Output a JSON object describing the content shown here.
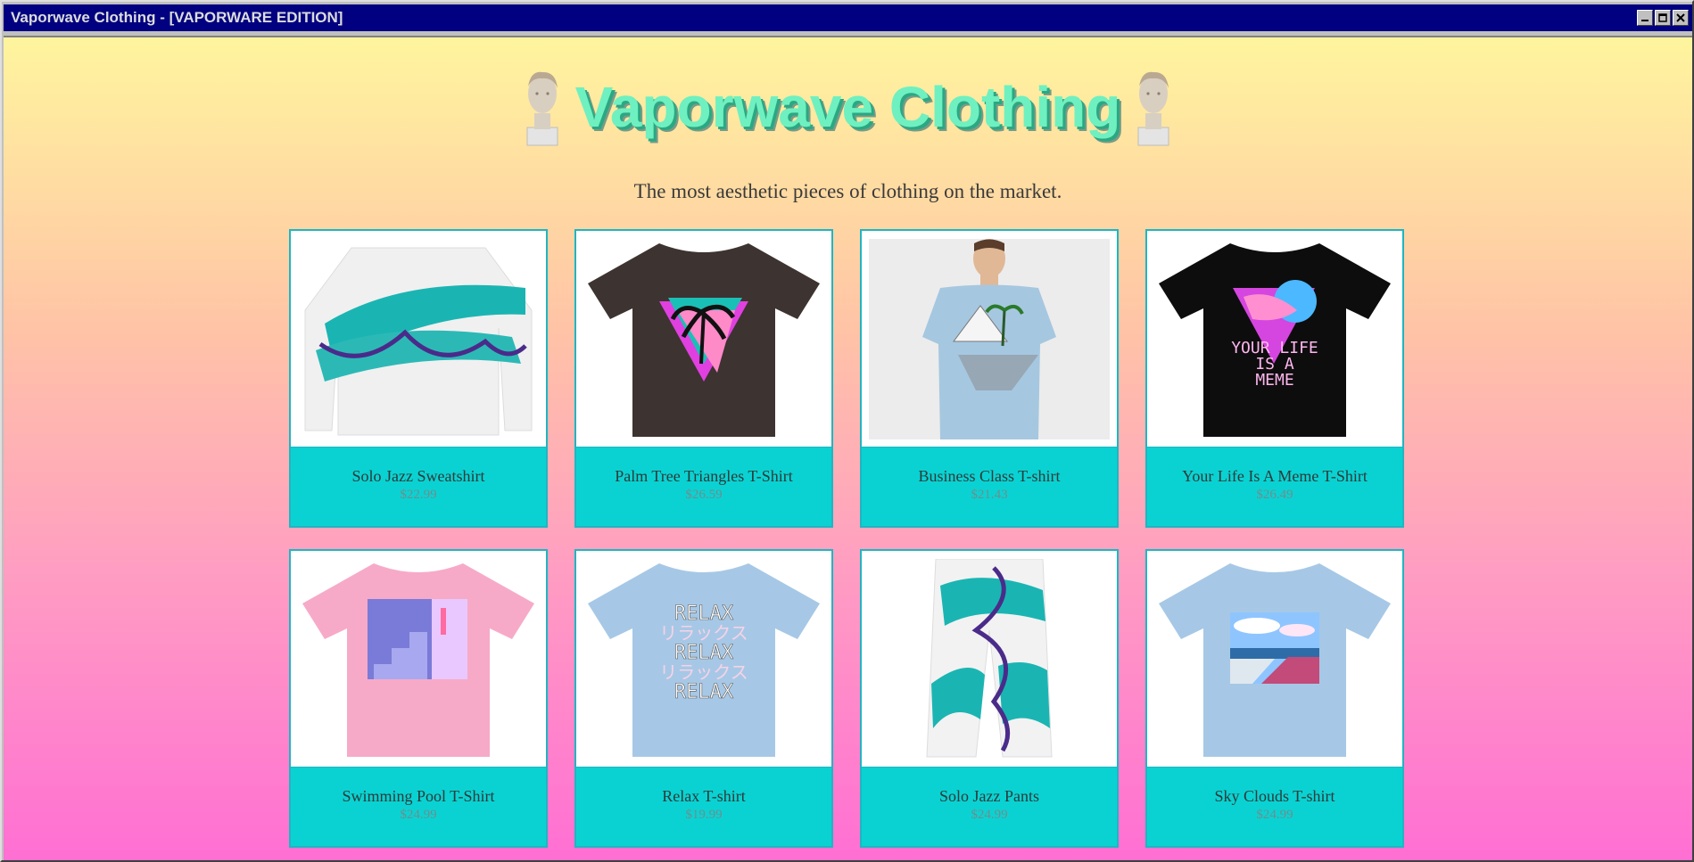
{
  "window": {
    "title": "Vaporwave Clothing - [VAPORWARE EDITION]",
    "buttons": [
      "minimize",
      "maximize",
      "close"
    ]
  },
  "header": {
    "title": "Vaporwave Clothing",
    "tagline": "The most aesthetic pieces of clothing on the market."
  },
  "colors": {
    "gradient_top": "#fff59e",
    "gradient_bottom": "#ff6fd3",
    "card_bg": "#0bd2d2",
    "card_border": "#1eb6c2",
    "logo_text": "#6ff0c0",
    "titlebar": "#000080"
  },
  "products": [
    {
      "name": "Solo Jazz Sweatshirt",
      "price": "$22.99",
      "icon": "sweatshirt-image"
    },
    {
      "name": "Palm Tree Triangles T-Shirt",
      "price": "$26.59",
      "icon": "tshirt-image"
    },
    {
      "name": "Business Class T-shirt",
      "price": "$21.43",
      "icon": "tshirt-image"
    },
    {
      "name": "Your Life Is A Meme T-Shirt",
      "price": "$26.49",
      "icon": "tshirt-image",
      "print_text": "YOUR LIFE IS A MEME"
    },
    {
      "name": "Swimming Pool T-Shirt",
      "price": "$24.99",
      "icon": "tshirt-image"
    },
    {
      "name": "Relax T-shirt",
      "price": "$19.99",
      "icon": "tshirt-image",
      "print_text": "RELAX リラックス RELAX リラックス RELAX"
    },
    {
      "name": "Solo Jazz Pants",
      "price": "$24.99",
      "icon": "pants-image"
    },
    {
      "name": "Sky Clouds T-shirt",
      "price": "$24.99",
      "icon": "tshirt-image"
    }
  ]
}
